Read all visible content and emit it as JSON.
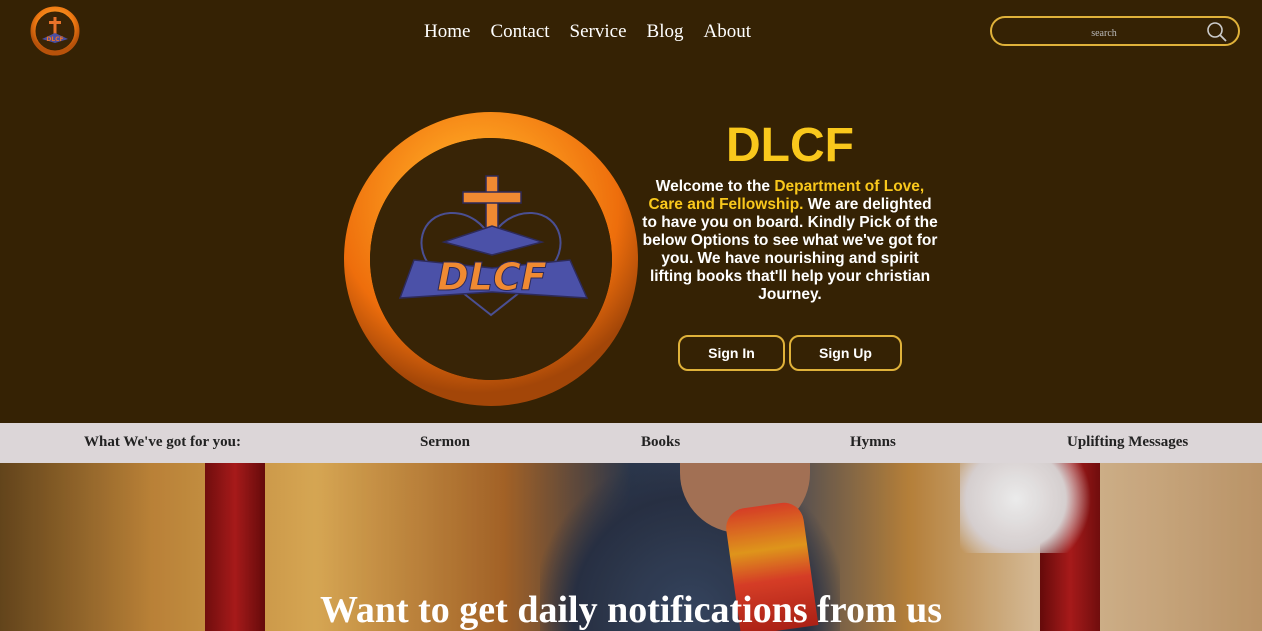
{
  "header": {
    "logo_icon": "dlcf-logo-icon",
    "nav": [
      {
        "label": "Home"
      },
      {
        "label": "Contact"
      },
      {
        "label": "Service"
      },
      {
        "label": "Blog"
      },
      {
        "label": "About"
      }
    ],
    "search": {
      "placeholder": "search",
      "icon": "search-icon"
    }
  },
  "hero": {
    "logo_icon": "dlcf-emblem-icon",
    "title": "DLCF",
    "intro_before": "Welcome to the ",
    "intro_highlight": "Department of Love, Care and Fellowship.",
    "intro_after": " We are delighted to have you on board. Kindly Pick of the below Options to see what we've got for you. We have nourishing and spirit lifting books that'll help your christian Journey.",
    "sign_in": "Sign In",
    "sign_up": "Sign Up"
  },
  "categories": {
    "heading": "What We've got for you:",
    "items": [
      {
        "label": "Sermon"
      },
      {
        "label": "Books"
      },
      {
        "label": "Hymns"
      },
      {
        "label": "Uplifting Messages"
      }
    ]
  },
  "banner": {
    "title": "Want to get daily notifications from us"
  },
  "colors": {
    "background": "#352204",
    "accent": "#f9c81c",
    "border": "#e0b23a",
    "band": "#dcd6d8"
  }
}
